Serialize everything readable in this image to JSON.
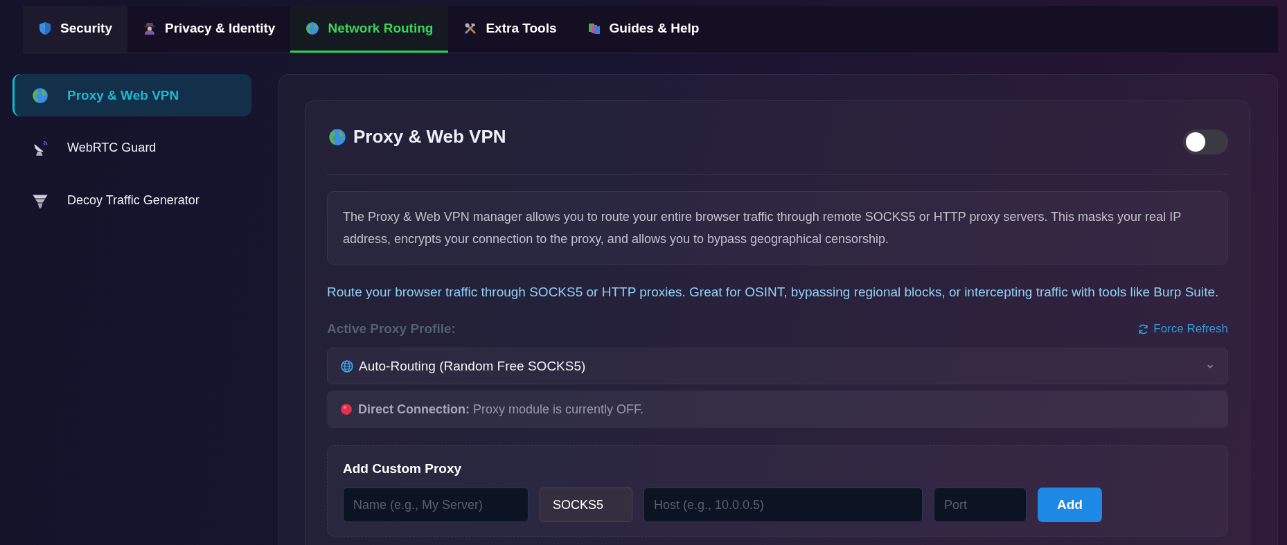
{
  "tabs": [
    {
      "label": "Security",
      "selected": false
    },
    {
      "label": "Privacy & Identity",
      "selected": false
    },
    {
      "label": "Network Routing",
      "selected": true
    },
    {
      "label": "Extra Tools",
      "selected": false
    },
    {
      "label": "Guides & Help",
      "selected": false
    }
  ],
  "sidebar": {
    "items": [
      {
        "label": "Proxy & Web VPN",
        "selected": true
      },
      {
        "label": "WebRTC Guard",
        "selected": false
      },
      {
        "label": "Decoy Traffic Generator",
        "selected": false
      }
    ]
  },
  "panel": {
    "title": "Proxy & Web VPN",
    "on": false,
    "description": "The Proxy & Web VPN manager allows you to route your entire browser traffic through remote SOCKS5 or HTTP proxy servers. This masks your real IP address, encrypts your connection to the proxy, and allows you to bypass geographical censorship.",
    "intro": "Route your browser traffic through SOCKS5 or HTTP proxies. Great for OSINT, bypassing regional blocks, or intercepting traffic with tools like Burp Suite.",
    "profile_label": "Active Proxy Profile:",
    "refresh_label": "Force Refresh",
    "profile_select": {
      "value": "Auto-Routing (Random Free SOCKS5)"
    },
    "status": {
      "active": false,
      "text": "**Direct Connection:** Proxy module is currently OFF."
    },
    "custom_proxy": {
      "title": "Add Custom Proxy",
      "fields": [
        {
          "kind": "input",
          "placeholder": "Name (e.g., My Server)"
        },
        {
          "kind": "select",
          "value": "SOCKS5"
        },
        {
          "kind": "input",
          "placeholder": "Host (e.g., 10.0.0.5)"
        },
        {
          "kind": "input",
          "placeholder": "Port"
        }
      ],
      "button": "Add"
    }
  }
}
